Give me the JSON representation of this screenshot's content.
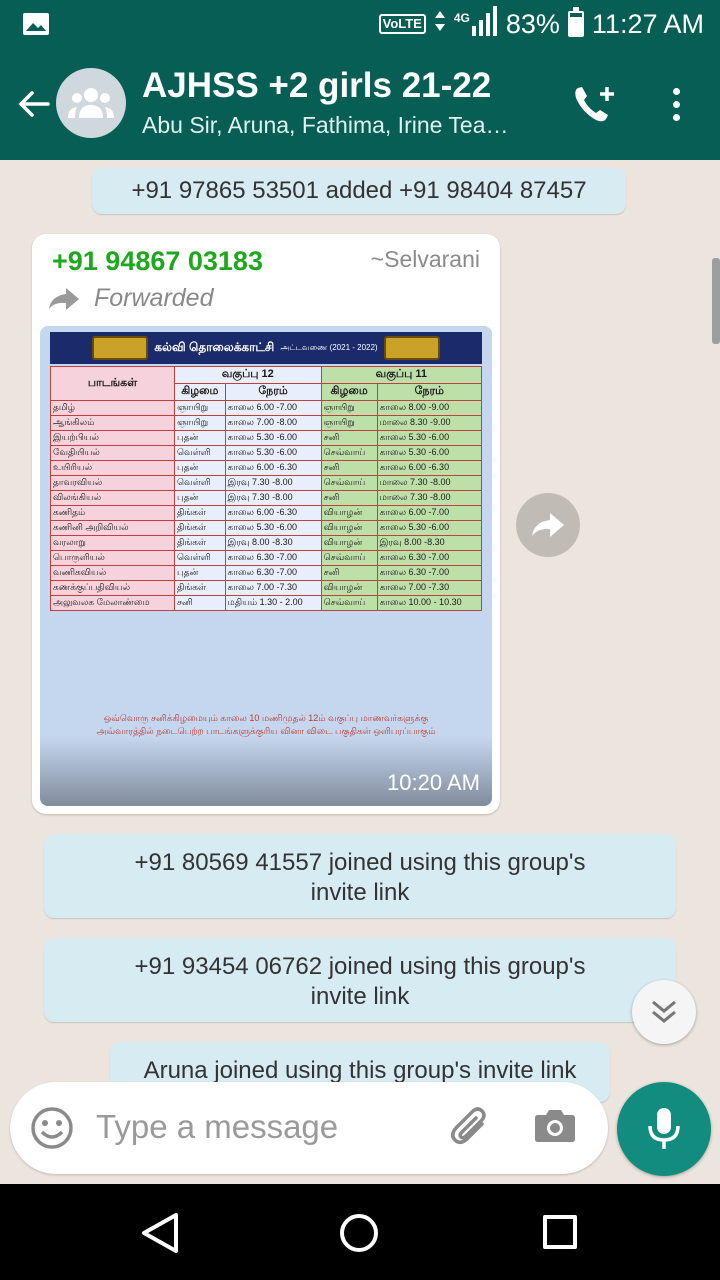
{
  "status_bar": {
    "volte": "VoLTE",
    "network": "4G",
    "battery_percent": "83%",
    "battery_level": 0.83,
    "time": "11:27 AM"
  },
  "header": {
    "title": "AJHSS +2 girls 21-22",
    "subtitle": "Abu Sir, Aruna, Fathima, Irine Tea…",
    "color": "#075E54"
  },
  "system_messages": [
    "+91 97865 53501 added +91 98404 87457",
    "+91 80569 41557 joined using this group's invite link",
    "+91 93454 06762 joined using this group's invite link",
    "Aruna joined using this group's invite link"
  ],
  "message": {
    "sender": "+91 94867 03183",
    "alias": "~Selvarani",
    "forwarded_label": "Forwarded",
    "time": "10:20 AM"
  },
  "schedule_image": {
    "channel": "கல்வி தொலைக்காட்சி",
    "title_suffix": "அட்டவணை (2021 - 2022)",
    "headers": {
      "subject": "பாடங்கள்",
      "class12": "வகுப்பு 12",
      "class11": "வகுப்பு 11",
      "day": "கிழமை",
      "time": "நேரம்"
    },
    "rows": [
      [
        "தமிழ்",
        "ஞாயிறு",
        "காலை 6.00 -7.00",
        "ஞாயிறு",
        "காலை 8.00 -9.00"
      ],
      [
        "ஆங்கிலம்",
        "ஞாயிறு",
        "காலை 7.00 -8.00",
        "ஞாயிறு",
        "மாலை 8.30 -9.00"
      ],
      [
        "இயற்பியல்",
        "புதன்",
        "காலை 5.30 -6.00",
        "சனி",
        "காலை 5.30 -6.00"
      ],
      [
        "வேதியியல்",
        "வெள்ளி",
        "காலை 5.30 -6.00",
        "செவ்வாய்",
        "காலை 5.30 -6.00"
      ],
      [
        "உயிரியல்",
        "புதன்",
        "காலை 6.00 -6.30",
        "சனி",
        "காலை 6.00 -6.30"
      ],
      [
        "தாவரவியல்",
        "வெள்ளி",
        "இரவு 7.30 -8.00",
        "செவ்வாய்",
        "மாலை 7.30 -8.00"
      ],
      [
        "விலங்கியல்",
        "புதன்",
        "இரவு 7.30 -8.00",
        "சனி",
        "மாலை 7.30 -8.00"
      ],
      [
        "கணிதம்",
        "திங்கள்",
        "காலை 6.00 -6.30",
        "வியாழன்",
        "காலை 6.00 -7.00"
      ],
      [
        "கணினி அறிவியல்",
        "திங்கள்",
        "காலை 5.30 -6.00",
        "வியாழன்",
        "காலை 5.30 -6.00"
      ],
      [
        "வரலாறு",
        "திங்கள்",
        "இரவு 8.00 -8.30",
        "வியாழன்",
        "இரவு 8.00 -8.30"
      ],
      [
        "பொருளியல்",
        "வெள்ளி",
        "காலை 6.30 -7.00",
        "செவ்வாய்",
        "காலை 6.30 -7.00"
      ],
      [
        "வணிகவியல்",
        "புதன்",
        "காலை 6.30 -7.00",
        "சனி",
        "காலை 6.30 -7.00"
      ],
      [
        "கணக்குப்பதிவியல்",
        "திங்கள்",
        "காலை 7.00 -7.30",
        "வியாழன்",
        "காலை 7.00 -7.30"
      ],
      [
        "அலுவலக மேலாண்மை",
        "சனி",
        "மதியம் 1.30 - 2.00",
        "செவ்வாய்",
        "காலை 10.00 - 10.30"
      ]
    ],
    "note_line1": "ஒவ்வொரு சனிக்கிழமையும் காலை 10 மணிமுதல் 12ம் வகுப்பு மாணவர்களுக்கு",
    "note_line2": "அவ்வாரத்தில் நடைபெற்ற பாடங்களுக்குரிய வினா விடை பகுதிகள் ஒளிபரப்பாகும்"
  },
  "input": {
    "placeholder": "Type a message"
  },
  "colors": {
    "accent": "#128C7E",
    "chat_bg": "#ece5dd",
    "system_bubble": "#d7ebf3",
    "sender_name": "#1ea81e"
  }
}
